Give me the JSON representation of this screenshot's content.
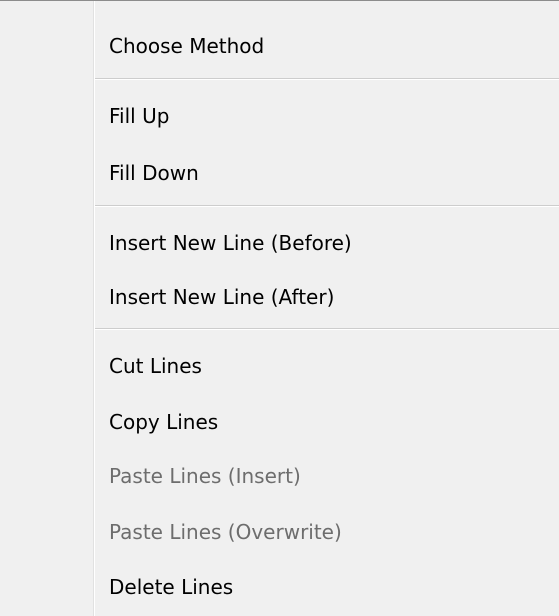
{
  "menu": {
    "items": [
      {
        "label": "Choose Method",
        "enabled": true
      },
      {
        "label": "Fill Up",
        "enabled": true
      },
      {
        "label": "Fill Down",
        "enabled": true
      },
      {
        "label": "Insert New Line (Before)",
        "enabled": true
      },
      {
        "label": "Insert New Line (After)",
        "enabled": true
      },
      {
        "label": "Cut Lines",
        "enabled": true
      },
      {
        "label": "Copy Lines",
        "enabled": true
      },
      {
        "label": "Paste Lines (Insert)",
        "enabled": false
      },
      {
        "label": "Paste Lines (Overwrite)",
        "enabled": false
      },
      {
        "label": "Delete Lines",
        "enabled": true
      }
    ]
  }
}
